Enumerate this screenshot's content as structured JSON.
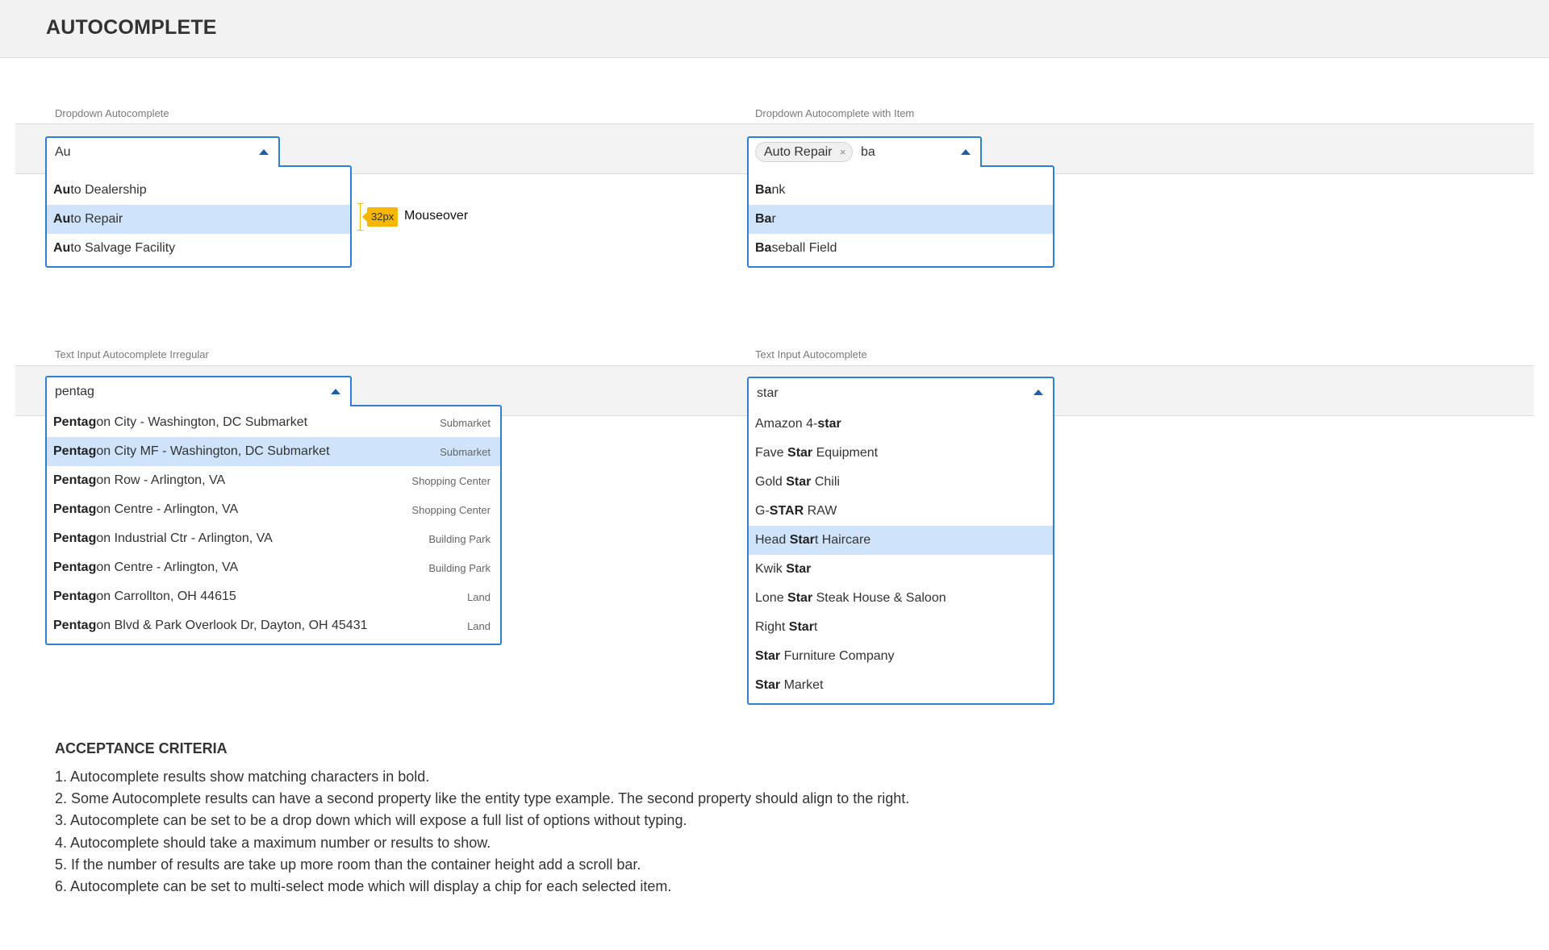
{
  "header": {
    "title": "AUTOCOMPLETE"
  },
  "dropdown_autocomplete": {
    "label": "Dropdown Autocomplete",
    "input_value": "Au",
    "items": [
      {
        "match": "Au",
        "rest": "to Dealership"
      },
      {
        "match": "Au",
        "rest": "to Repair",
        "selected": true
      },
      {
        "match": "Au",
        "rest": "to Salvage Facility"
      }
    ]
  },
  "annotation": {
    "badge": "32px",
    "text": "Mouseover"
  },
  "dropdown_autocomplete_item": {
    "label": "Dropdown Autocomplete with Item",
    "chip_label": "Auto Repair",
    "chip_close": "×",
    "input_value": "ba",
    "items": [
      {
        "match": "Ba",
        "rest": "nk"
      },
      {
        "match": "Ba",
        "rest": "r",
        "selected": true
      },
      {
        "match": "Ba",
        "rest": "seball Field"
      }
    ]
  },
  "text_input_irregular": {
    "label": "Text Input Autocomplete Irregular",
    "input_value": "pentag",
    "items": [
      {
        "match": "Pentag",
        "rest": "on City - Washington, DC Submarket",
        "type": "Submarket"
      },
      {
        "match": "Pentag",
        "rest": "on City MF - Washington, DC Submarket",
        "type": "Submarket",
        "selected": true
      },
      {
        "match": "Pentag",
        "rest": "on Row - Arlington, VA",
        "type": "Shopping Center"
      },
      {
        "match": "Pentag",
        "rest": "on Centre - Arlington, VA",
        "type": "Shopping Center"
      },
      {
        "match": "Pentag",
        "rest": "on Industrial Ctr - Arlington, VA",
        "type": "Building Park"
      },
      {
        "match": "Pentag",
        "rest": "on Centre - Arlington, VA",
        "type": "Building Park"
      },
      {
        "match": "Pentag",
        "rest": "on Carrollton, OH 44615",
        "type": "Land"
      },
      {
        "match": "Pentag",
        "rest": "on Blvd & Park Overlook Dr, Dayton, OH 45431",
        "type": "Land"
      }
    ]
  },
  "text_input": {
    "label": "Text Input Autocomplete",
    "input_value": "star",
    "items": [
      {
        "parts": [
          [
            "Amazon 4-",
            false
          ],
          [
            "star",
            true
          ]
        ]
      },
      {
        "parts": [
          [
            "Fave ",
            false
          ],
          [
            "Star",
            true
          ],
          [
            " Equipment",
            false
          ]
        ]
      },
      {
        "parts": [
          [
            "Gold ",
            false
          ],
          [
            "Star",
            true
          ],
          [
            " Chili",
            false
          ]
        ]
      },
      {
        "parts": [
          [
            "G-",
            false
          ],
          [
            "STAR",
            true
          ],
          [
            " RAW",
            false
          ]
        ]
      },
      {
        "parts": [
          [
            "Head ",
            false
          ],
          [
            "Star",
            true
          ],
          [
            "t Haircare",
            false
          ]
        ],
        "selected": true
      },
      {
        "parts": [
          [
            "Kwik ",
            false
          ],
          [
            "Star",
            true
          ]
        ]
      },
      {
        "parts": [
          [
            "Lone ",
            false
          ],
          [
            "Star",
            true
          ],
          [
            " Steak House & Saloon",
            false
          ]
        ]
      },
      {
        "parts": [
          [
            "Right ",
            false
          ],
          [
            "Star",
            true
          ],
          [
            "t",
            false
          ]
        ]
      },
      {
        "parts": [
          [
            "Star",
            true
          ],
          [
            " Furniture Company",
            false
          ]
        ]
      },
      {
        "parts": [
          [
            "Star",
            true
          ],
          [
            " Market",
            false
          ]
        ]
      }
    ]
  },
  "acceptance": {
    "title": "ACCEPTANCE CRITERIA",
    "items": [
      "1. Autocomplete results show matching characters in bold.",
      "2. Some Autocomplete results can have a second property like the entity type example. The second property should align to the right.",
      "3. Autocomplete can be set to be a drop down which will expose a full list of options without typing.",
      "4. Autocomplete should take a maximum number or results to show.",
      "5. If the number of results are take up more room than the container height add a scroll bar.",
      "6. Autocomplete can be set to multi-select mode which will display a chip for each selected item."
    ]
  },
  "colors": {
    "accent_border": "#2f7fd3",
    "selected_row": "#cfe3fb",
    "annotation": "#f5b700"
  },
  "icons": {
    "caret": "caret-up-icon",
    "chip_close": "close-icon"
  }
}
